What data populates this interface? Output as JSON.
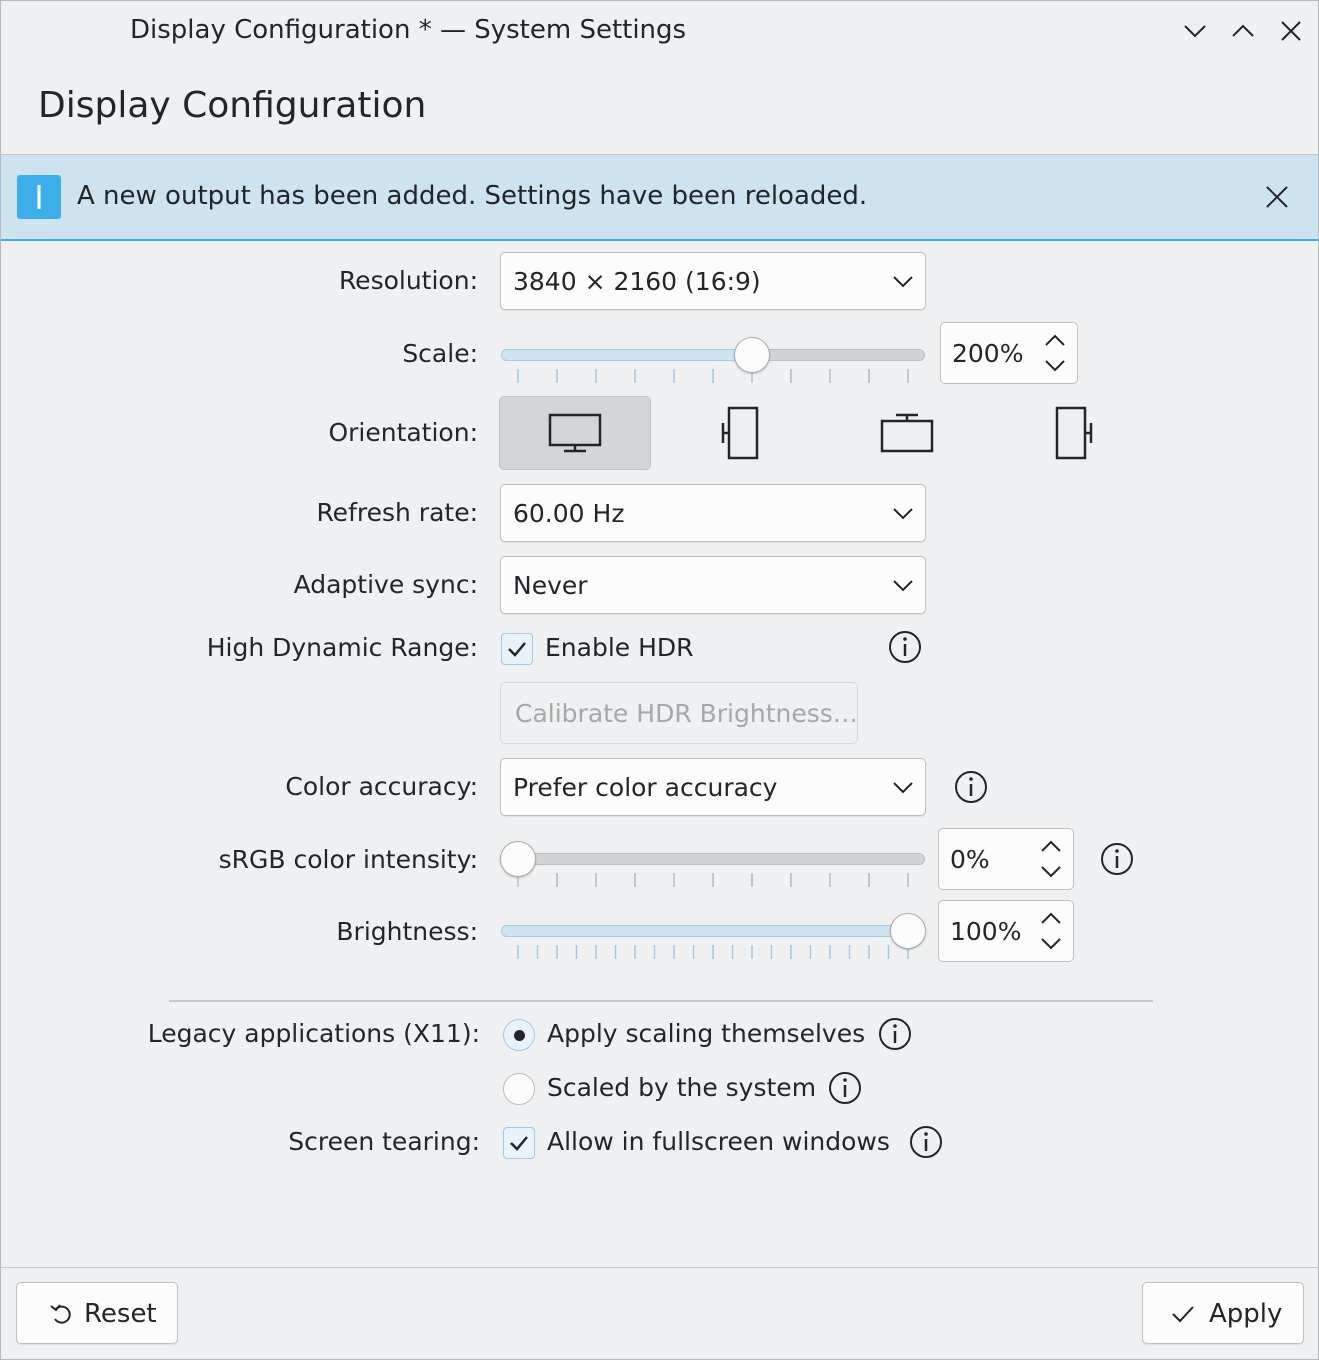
{
  "window": {
    "title": "Display Configuration * — System Settings",
    "controls": [
      "minimize-icon",
      "maximize-icon",
      "close-icon"
    ]
  },
  "page": {
    "heading": "Display Configuration"
  },
  "banner": {
    "message": "A new output has been added. Settings have been reloaded.",
    "icon": "info-icon",
    "accent_color": "#3daee9",
    "background": "#cde3f0"
  },
  "form": {
    "resolution": {
      "label": "Resolution:",
      "value": "3840 × 2160 (16:9)"
    },
    "scale": {
      "label": "Scale:",
      "value": "200%",
      "slider_fraction": 0.6
    },
    "orientation": {
      "label": "Orientation:",
      "options": [
        "landscape",
        "portrait-left",
        "landscape-flipped",
        "portrait-right"
      ],
      "selected": "landscape"
    },
    "refresh_rate": {
      "label": "Refresh rate:",
      "value": "60.00 Hz"
    },
    "adaptive_sync": {
      "label": "Adaptive sync:",
      "value": "Never"
    },
    "hdr": {
      "label": "High Dynamic Range:",
      "checkbox_label": "Enable HDR",
      "checked": true,
      "calibrate_button": "Calibrate HDR Brightness…"
    },
    "color_accuracy": {
      "label": "Color accuracy:",
      "value": "Prefer color accuracy"
    },
    "srgb_intensity": {
      "label": "sRGB color intensity:",
      "value": "0%",
      "slider_fraction": 0.0
    },
    "brightness": {
      "label": "Brightness:",
      "value": "100%",
      "slider_fraction": 1.0
    },
    "legacy_apps": {
      "label": "Legacy applications (X11):",
      "options": [
        "Apply scaling themselves",
        "Scaled by the system"
      ],
      "selected": "Apply scaling themselves"
    },
    "screen_tearing": {
      "label": "Screen tearing:",
      "checkbox_label": "Allow in fullscreen windows",
      "checked": true
    }
  },
  "footer": {
    "reset_label": "Reset",
    "apply_label": "Apply"
  }
}
